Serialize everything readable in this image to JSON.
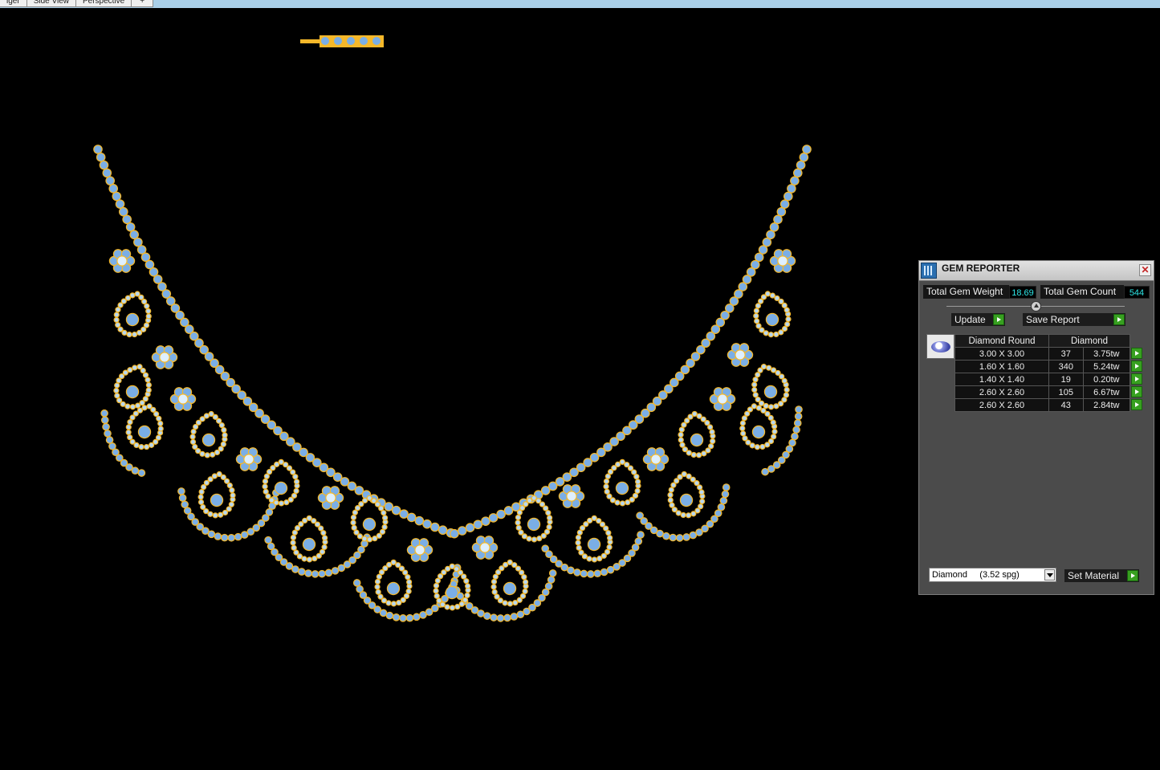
{
  "tabs": [
    "iger",
    "Side View",
    "Perspective",
    "+"
  ],
  "gem_reporter": {
    "title": "GEM REPORTER",
    "close": "✕",
    "total_gem_weight_label": "Total Gem Weight",
    "total_gem_weight": "18.69",
    "total_gem_count_label": "Total Gem Count",
    "total_gem_count": "544",
    "update_label": "Update",
    "save_report_label": "Save Report",
    "table": {
      "headers": [
        "Diamond Round",
        "Diamond"
      ],
      "rows": [
        {
          "size": "3.00 X 3.00",
          "count": "37",
          "weight": "3.75tw"
        },
        {
          "size": "1.60 X 1.60",
          "count": "340",
          "weight": "5.24tw"
        },
        {
          "size": "1.40 X 1.40",
          "count": "19",
          "weight": "0.20tw"
        },
        {
          "size": "2.60 X 2.60",
          "count": "105",
          "weight": "6.67tw"
        },
        {
          "size": "2.60 X 2.60",
          "count": "43",
          "weight": "2.84tw"
        }
      ]
    },
    "material": "Diamond     (3.52 spg)",
    "set_material_label": "Set Material"
  },
  "colors": {
    "gold": "#f5b82a",
    "gem": "#7aaee6",
    "gem_pale": "#b8d8f0",
    "background": "#000000"
  }
}
